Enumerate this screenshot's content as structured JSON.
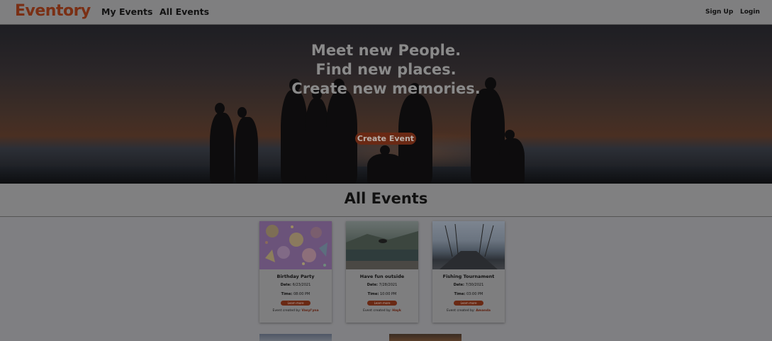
{
  "nav": {
    "brand": "Eventory",
    "links": [
      "My Events",
      "All Events"
    ],
    "sign_up": "Sign Up",
    "login": "Login"
  },
  "hero": {
    "lines": [
      "Meet new People.",
      "Find new places.",
      "Create new memories."
    ],
    "cta": "Create Event"
  },
  "section_title": "All Events",
  "labels": {
    "date": "Date:",
    "time": "Time:",
    "learn_more": "Learn more",
    "created_by": "Event created by:"
  },
  "events": [
    {
      "title": "Birthday Party",
      "date": "6/23/2021",
      "time": "08:00 PM",
      "creator": "Vasyl'yna"
    },
    {
      "title": "Have fun outside",
      "date": "7/28/2021",
      "time": "10:00 PM",
      "creator": "Hayk"
    },
    {
      "title": "Fishing Tournament",
      "date": "7/30/2021",
      "time": "03:00 PM",
      "creator": "Amanda"
    }
  ],
  "colors": {
    "brand": "#7a2f14",
    "accent": "#6a2914",
    "overlay": "#7f7f82"
  }
}
